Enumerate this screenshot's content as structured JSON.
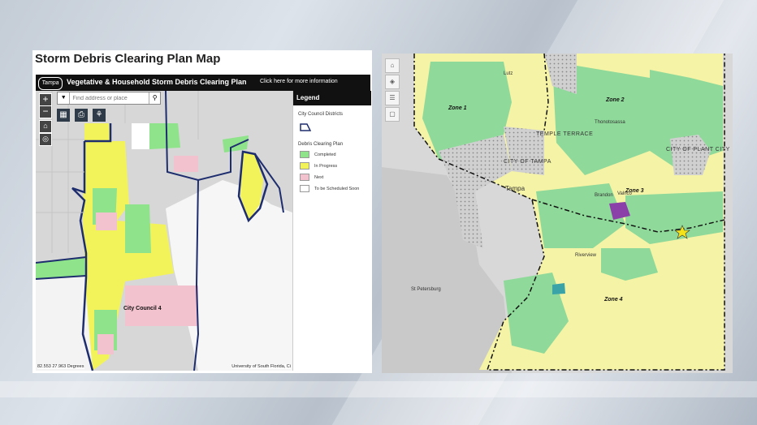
{
  "left_panel": {
    "title": "Storm Debris Clearing Plan Map",
    "app_bar": {
      "logo_text": "Tampa",
      "title": "Vegetative & Household Storm Debris Clearing Plan",
      "link_text": "Click here for more information"
    },
    "search": {
      "placeholder": "Find address or place"
    },
    "zoom": {
      "in": "+",
      "out": "−"
    },
    "map_labels": {
      "council": "City Council 4"
    },
    "coords": "82.553 27.963 Degrees",
    "attribution": "University of South Florida, Ci",
    "legend": {
      "header": "Legend",
      "districts_title": "City Council Districts",
      "plan_title": "Debris Clearing Plan",
      "items": [
        {
          "label": "Completed",
          "color": "#8fe38a"
        },
        {
          "label": "In Progress",
          "color": "#f2f35a"
        },
        {
          "label": "Next",
          "color": "#f3c2cf"
        },
        {
          "label": "To be Scheduled Soon",
          "color": "#ffffff"
        }
      ]
    }
  },
  "right_panel": {
    "zones": [
      "Zone 1",
      "Zone 2",
      "Zone 3",
      "Zone 4"
    ],
    "places": {
      "temple_terrace": "TEMPLE TERRACE",
      "city_of_tampa": "CITY OF TAMPA",
      "tampa": "Tampa",
      "plant_city": "CITY OF PLANT CITY",
      "brandon": "Brandon",
      "riverview": "Riverview",
      "st_petersburg": "St Petersburg",
      "valrico": "Valrico",
      "thonotosassa": "Thonotosassa",
      "lutz": "Lutz"
    },
    "colors": {
      "completed": "#8fd99a",
      "in_progress": "#f5f3a6",
      "purple": "#8b3fa8",
      "star": "#f4e21a"
    }
  }
}
